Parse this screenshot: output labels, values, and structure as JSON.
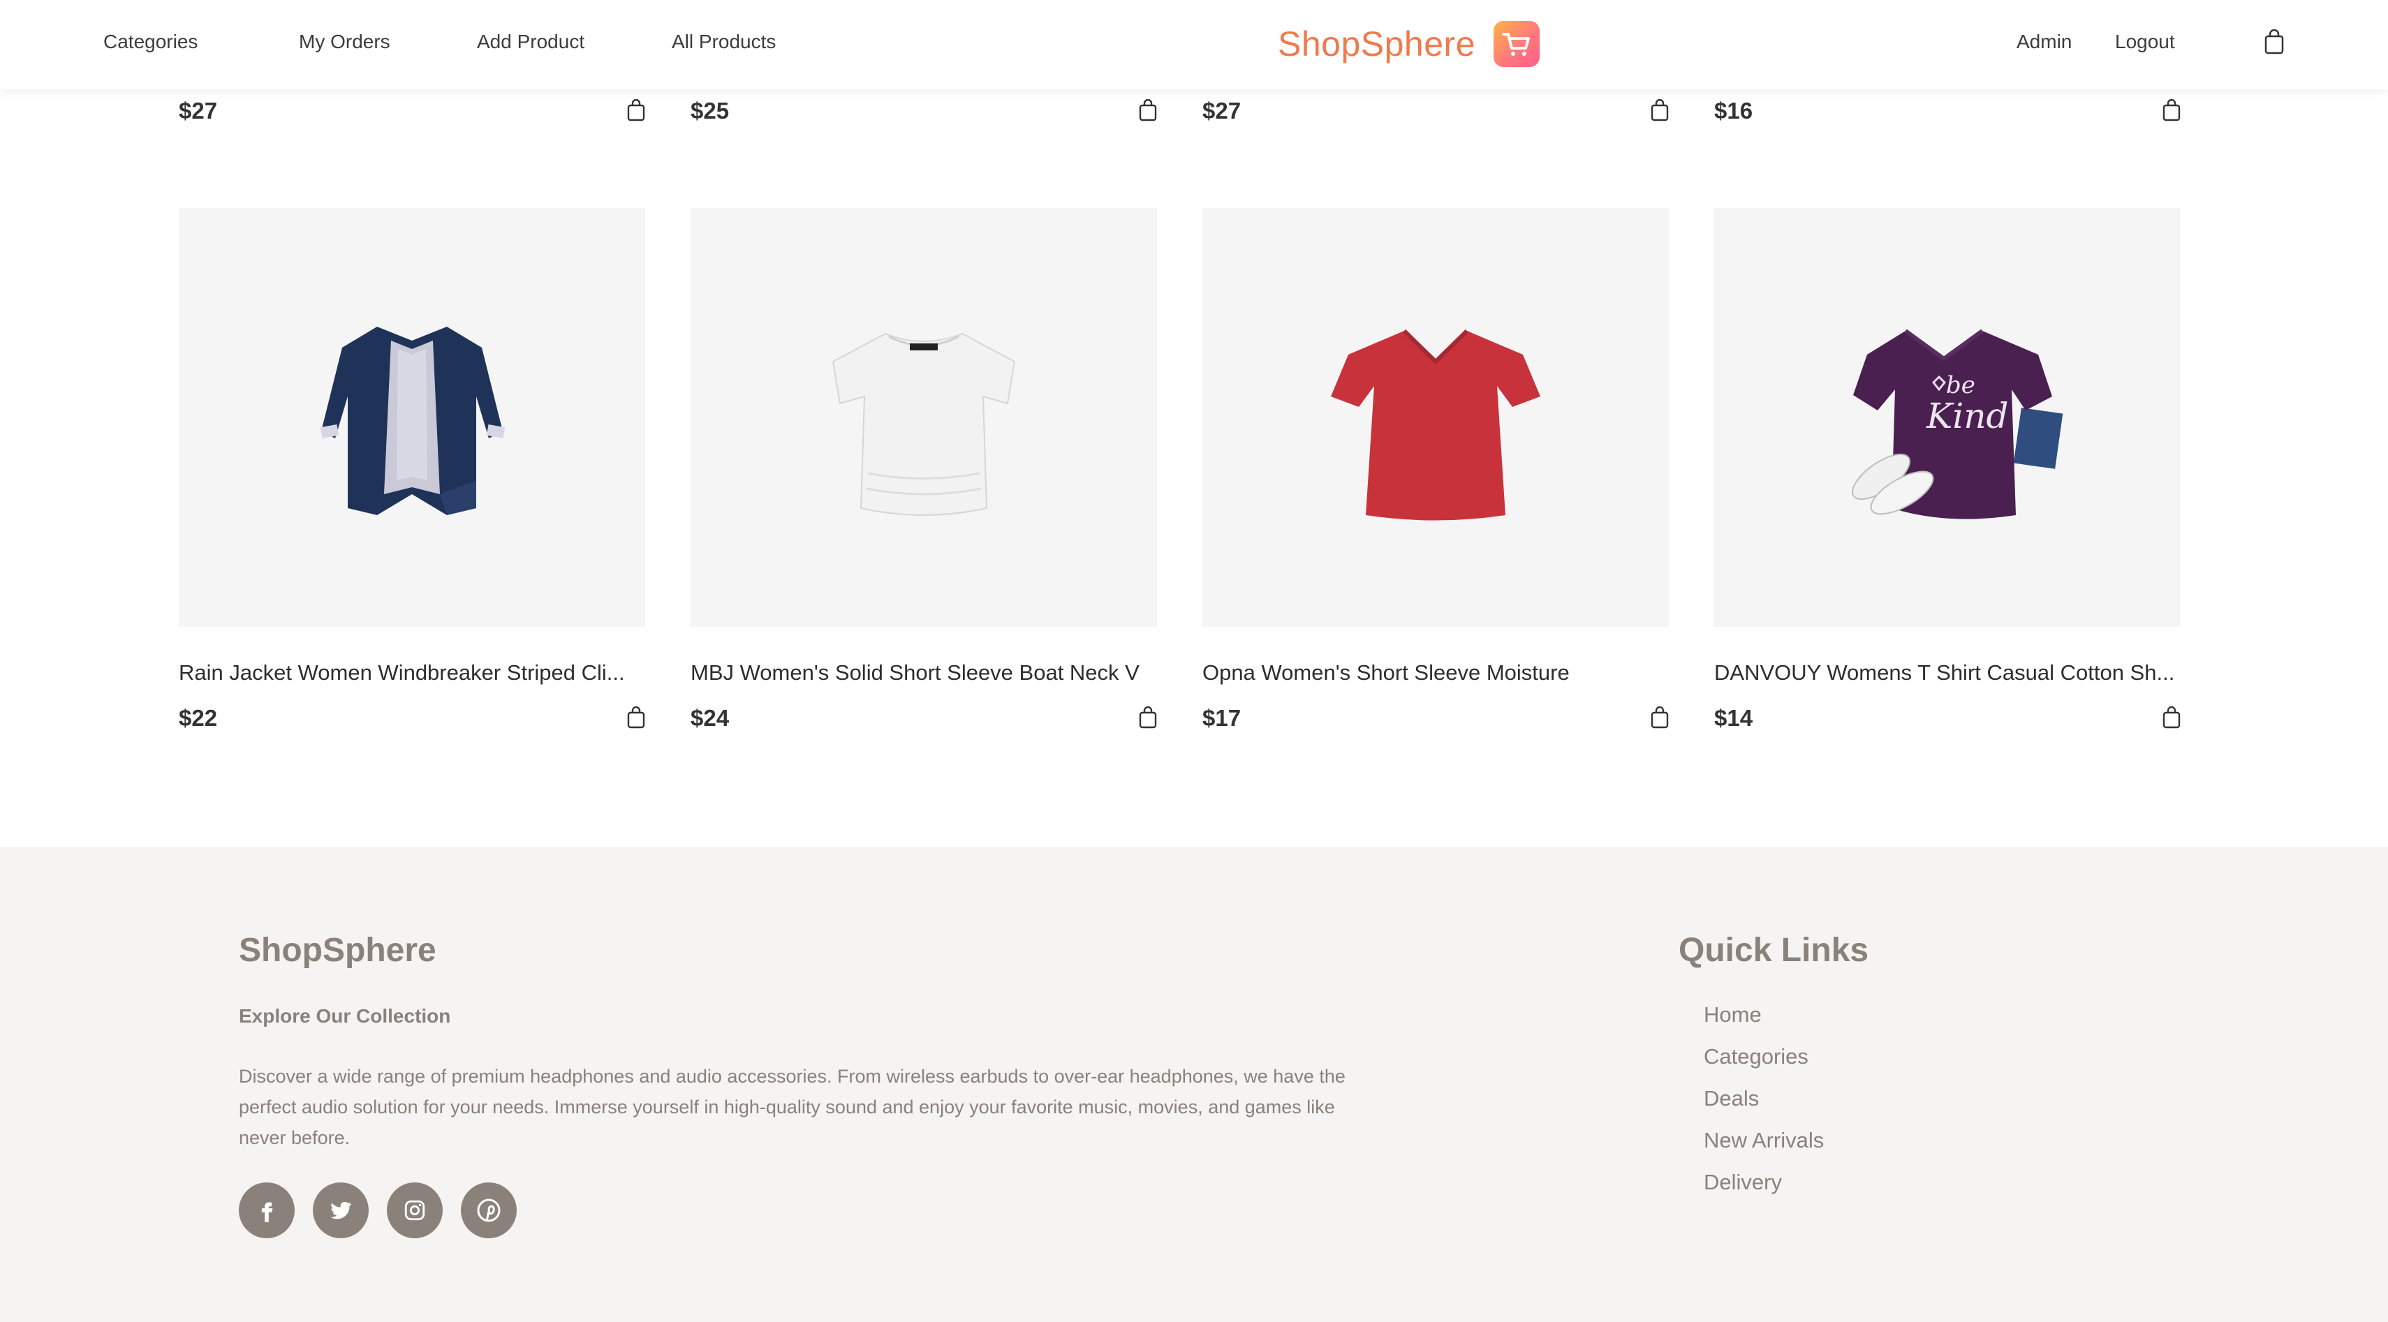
{
  "nav": {
    "categories": "Categories",
    "my_orders": "My Orders",
    "add_product": "Add Product",
    "all_products": "All Products",
    "admin": "Admin",
    "logout": "Logout"
  },
  "brand": {
    "name": "ShopSphere",
    "accent": "#f07a4c"
  },
  "top_prices": [
    "$27",
    "$25",
    "$27",
    "$16"
  ],
  "products": [
    {
      "title": "Rain Jacket Women Windbreaker Striped Cli...",
      "price": "$22",
      "image": "navy-jacket"
    },
    {
      "title": "MBJ Women's Solid Short Sleeve Boat Neck V",
      "price": "$24",
      "image": "white-tshirt"
    },
    {
      "title": "Opna Women's Short Sleeve Moisture",
      "price": "$17",
      "image": "red-tshirt"
    },
    {
      "title": "DANVOUY Womens T Shirt Casual Cotton Sh...",
      "price": "$14",
      "image": "purple-tshirt"
    }
  ],
  "footer": {
    "brand": "ShopSphere",
    "subtitle": "Explore Our Collection",
    "description": "Discover a wide range of premium headphones and audio accessories. From wireless earbuds to over-ear headphones, we have the perfect audio solution for your needs. Immerse yourself in high-quality sound and enjoy your favorite music, movies, and games like never before.",
    "socials": [
      "facebook-icon",
      "twitter-icon",
      "instagram-icon",
      "pinterest-icon"
    ],
    "quick_links_title": "Quick Links",
    "quick_links": [
      "Home",
      "Categories",
      "Deals",
      "New Arrivals",
      "Delivery"
    ]
  }
}
